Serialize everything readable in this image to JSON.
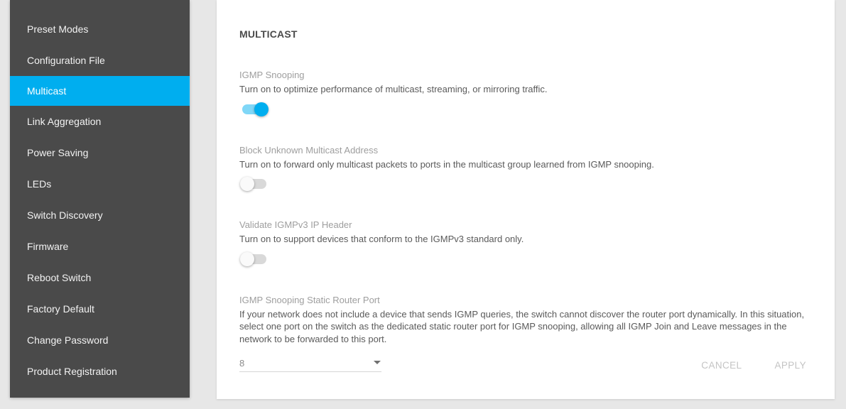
{
  "sidebar": {
    "items": [
      {
        "label": "Preset Modes"
      },
      {
        "label": "Configuration File"
      },
      {
        "label": "Multicast"
      },
      {
        "label": "Link Aggregation"
      },
      {
        "label": "Power Saving"
      },
      {
        "label": "LEDs"
      },
      {
        "label": "Switch Discovery"
      },
      {
        "label": "Firmware"
      },
      {
        "label": "Reboot Switch"
      },
      {
        "label": "Factory Default"
      },
      {
        "label": "Change Password"
      },
      {
        "label": "Product Registration"
      }
    ],
    "active_index": 2
  },
  "page": {
    "title": "MULTICAST"
  },
  "settings": {
    "igmp_snooping": {
      "label": "IGMP Snooping",
      "desc": "Turn on to optimize performance of multicast, streaming, or mirroring traffic.",
      "on": true
    },
    "block_unknown": {
      "label": "Block Unknown Multicast Address",
      "desc": "Turn on to forward only multicast packets to ports in the multicast group learned from IGMP snooping.",
      "on": false
    },
    "validate_header": {
      "label": "Validate IGMPv3 IP Header",
      "desc": "Turn on to support devices that conform to the IGMPv3 standard only.",
      "on": false
    },
    "static_router_port": {
      "label": "IGMP Snooping Static Router Port",
      "desc": "If your network does not include a device that sends IGMP queries, the switch cannot discover the router port dynamically. In this situation, select one port on the switch as the dedicated static router port for IGMP snooping, allowing all IGMP Join and Leave messages in the network to be forwarded to this port.",
      "value": "8"
    }
  },
  "actions": {
    "cancel": "CANCEL",
    "apply": "APPLY"
  }
}
